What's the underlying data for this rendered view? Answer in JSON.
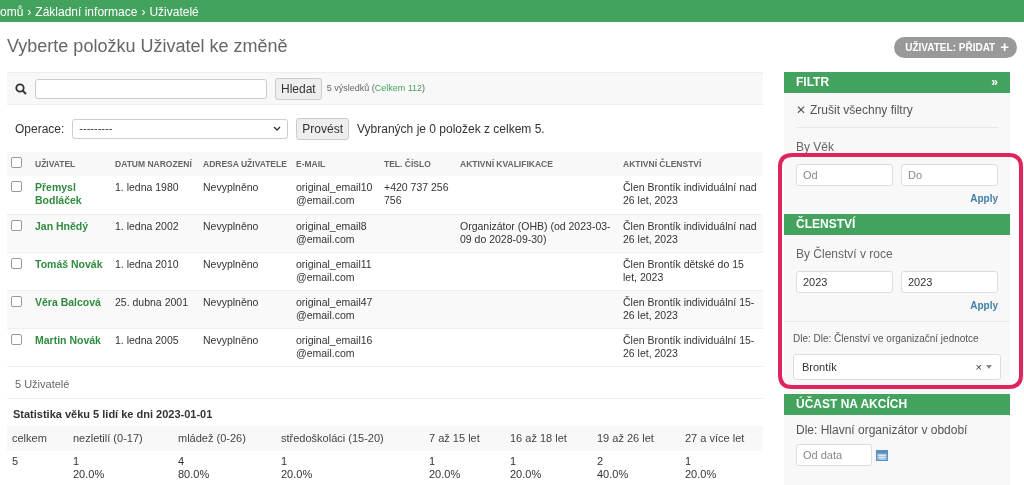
{
  "breadcrumb": {
    "items": [
      "omů",
      "Základní informace",
      "Uživatelé"
    ],
    "separator": "›"
  },
  "title": "Vyberte položku Uživatel ke změně",
  "add_button": {
    "label": "UŽIVATEL: PŘIDAT",
    "icon": "+"
  },
  "search": {
    "button": "Hledat",
    "result": "5 výsledků (",
    "total": "Celkem 112",
    "result_end": ")"
  },
  "actions": {
    "label": "Operace:",
    "value": "---------",
    "button": "Provést",
    "counter": "Vybraných je 0 položek z celkem 5."
  },
  "table": {
    "all_checked": false,
    "columns": [
      "UŽIVATEL",
      "DATUM NAROZENÍ",
      "ADRESA UŽIVATELE",
      "E-MAIL",
      "TEL. ČÍSLO",
      "AKTIVNÍ KVALIFIKACE",
      "AKTIVNÍ ČLENSTVÍ"
    ],
    "rows": [
      {
        "checked": false,
        "cells": [
          "Přemysl Bodláček",
          "1. ledna 1980",
          "Nevyplněno",
          "original_email10 @email.com",
          "+420 737 256 756",
          "",
          "Člen Brontík individuální nad 26 let, 2023"
        ]
      },
      {
        "checked": false,
        "cells": [
          "Jan Hnědý",
          "1. ledna 2002",
          "Nevyplněno",
          "original_email8 @email.com",
          "",
          "Organizátor (OHB) (od 2023-03-09 do 2028-09-30)",
          "Člen Brontík individuální nad 26 let, 2023"
        ]
      },
      {
        "checked": false,
        "cells": [
          "Tomáš Novák",
          "1. ledna 2010",
          "Nevyplněno",
          "original_email11 @email.com",
          "",
          "",
          "Člen Brontík dětské do 15 let, 2023"
        ]
      },
      {
        "checked": false,
        "cells": [
          "Věra Balcová",
          "25. dubna 2001",
          "Nevyplněno",
          "original_email47 @email.com",
          "",
          "",
          "Člen Brontík individuální 15-26 let, 2023"
        ]
      },
      {
        "checked": false,
        "cells": [
          "Martin Novák",
          "1. ledna 2005",
          "Nevyplněno",
          "original_email16 @email.com",
          "",
          "",
          "Člen Brontík individuální 15-26 let, 2023"
        ]
      }
    ]
  },
  "paginator": "5 Uživatelé",
  "stats": {
    "title": "Statistika věku 5 lidí ke dni 2023-01-01",
    "columns": [
      "celkem",
      "nezletilí (0-17)",
      "mládež (0-26)",
      "středoškoláci (15-20)",
      "7 až 15 let",
      "16 až 18 let",
      "19 až 26 let",
      "27 a více let"
    ],
    "values": [
      {
        "count": "5"
      },
      {
        "count": "1",
        "percent": "20.0%"
      },
      {
        "count": "4",
        "percent": "80.0%"
      },
      {
        "count": "1",
        "percent": "20.0%"
      },
      {
        "count": "1",
        "percent": "20.0%"
      },
      {
        "count": "1",
        "percent": "20.0%"
      },
      {
        "count": "2",
        "percent": "40.0%"
      },
      {
        "count": "1",
        "percent": "20.0%"
      }
    ]
  },
  "sidebar": {
    "title": "FILTR",
    "toggle": "»",
    "items": [
      {
        "kind": "clear",
        "icon": "✕",
        "label": "Zrušit všechny filtry"
      },
      {
        "kind": "range",
        "title": "By Věk",
        "fields": [
          {
            "placeholder": "Od"
          },
          {
            "placeholder": "Do"
          }
        ],
        "apply": "Apply"
      },
      {
        "kind": "header",
        "label": "ČLENSTVÍ"
      },
      {
        "kind": "range",
        "title": "By Členství v roce",
        "fields": [
          {
            "value": "2023"
          },
          {
            "value": "2023"
          }
        ],
        "apply": "Apply"
      },
      {
        "kind": "select",
        "title": "Dle: Dle: Členství ve organizační jednotce",
        "value": "Brontík",
        "clear": "×"
      },
      {
        "kind": "header",
        "label": "ÚČAST NA AKCÍCH"
      },
      {
        "kind": "date",
        "title": "Dle: Hlavní organizátor v období",
        "fields": [
          {
            "placeholder": "Od data"
          }
        ]
      }
    ]
  }
}
